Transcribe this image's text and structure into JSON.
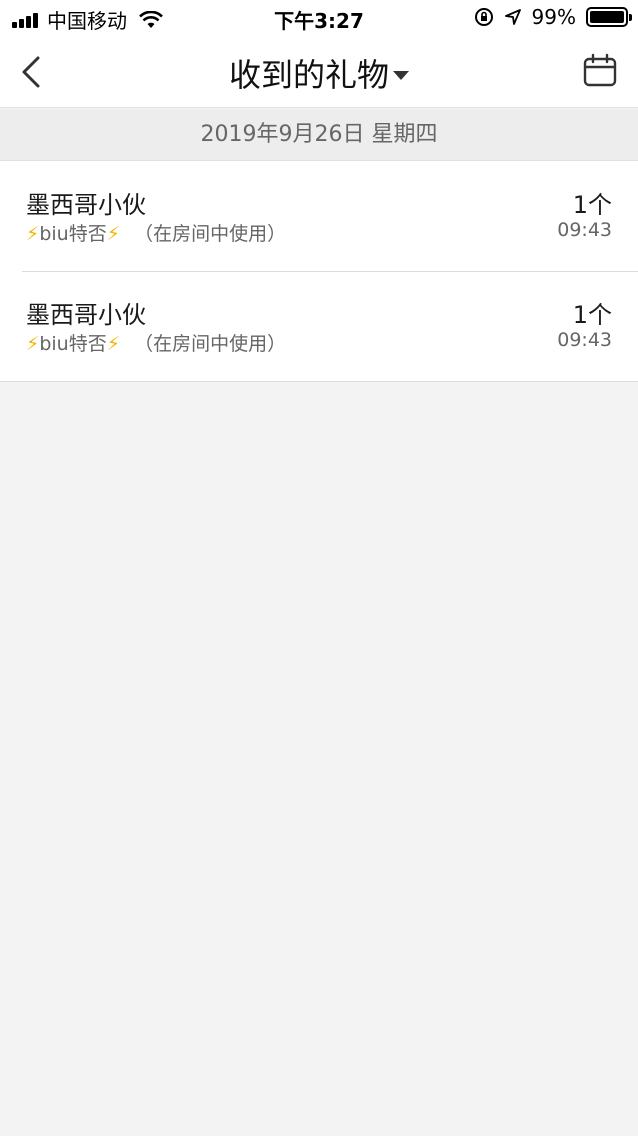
{
  "status_bar": {
    "carrier": "中国移动",
    "time": "下午3:27",
    "battery_pct": "99%"
  },
  "nav": {
    "title": "收到的礼物",
    "back_icon": "chevron-left-icon",
    "calendar_icon": "calendar-icon"
  },
  "date_header": "2019年9月26日 星期四",
  "gifts": [
    {
      "name": "墨西哥小伙",
      "sender_prefix": "⚡",
      "sender_name": "biu特否",
      "sender_suffix": "⚡",
      "note": "（在房间中使用）",
      "count": "1个",
      "time": "09:43"
    },
    {
      "name": "墨西哥小伙",
      "sender_prefix": "⚡",
      "sender_name": "biu特否",
      "sender_suffix": "⚡",
      "note": "（在房间中使用）",
      "count": "1个",
      "time": "09:43"
    }
  ],
  "colors": {
    "background": "#f3f3f3",
    "bolt": "#f2b705"
  }
}
